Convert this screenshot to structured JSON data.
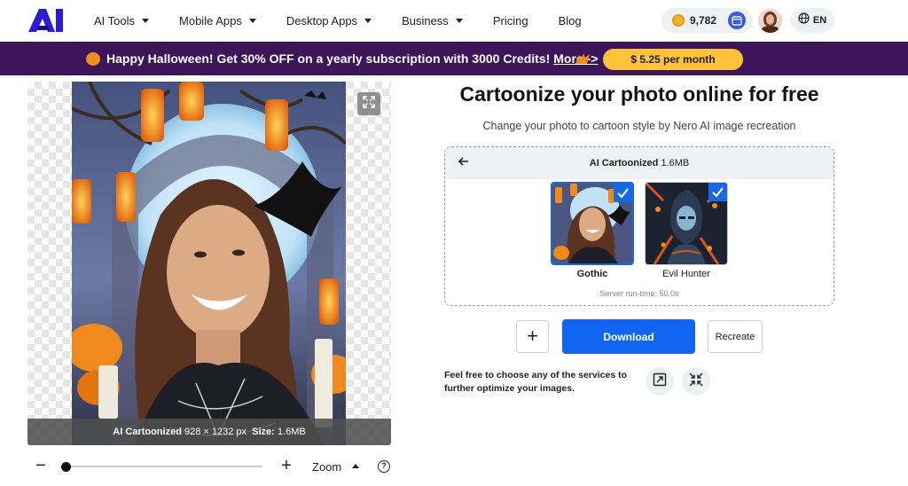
{
  "colors": {
    "brand": "#2d1cd6",
    "banner_bg": "#3d1559",
    "price_button": "#ffc23a",
    "primary": "#1265f0",
    "selected_border": "#1668e3"
  },
  "header": {
    "logo_text": "AI",
    "nav": [
      {
        "label": "AI Tools",
        "has_dropdown": true
      },
      {
        "label": "Mobile Apps",
        "has_dropdown": true
      },
      {
        "label": "Desktop Apps",
        "has_dropdown": true
      },
      {
        "label": "Business",
        "has_dropdown": true
      },
      {
        "label": "Pricing",
        "has_dropdown": false
      },
      {
        "label": "Blog",
        "has_dropdown": false
      }
    ],
    "credits": "9,782",
    "language": "EN",
    "icons": [
      "coin-icon",
      "calendar-icon",
      "user-avatar",
      "globe-icon"
    ]
  },
  "banner": {
    "text": "Happy Halloween! Get 30% OFF on a yearly subscription with 3000 Credits!",
    "link": "More ->",
    "price_button": "$ 5.25 per month"
  },
  "preview": {
    "caption_label": "AI Cartoonized",
    "caption_dims": "928 × 1232 px",
    "caption_size_label": "Size:",
    "caption_size": "1.6MB"
  },
  "zoom": {
    "minus": "−",
    "plus": "+",
    "label": "Zoom",
    "level": 0.0,
    "help": "?"
  },
  "main": {
    "title": "Cartoonize your photo online for free",
    "subtitle": "Change your photo to cartoon style by Nero AI image recreation",
    "result": {
      "title": "AI Cartoonized",
      "size": "1.6MB",
      "styles": [
        {
          "label": "Gothic",
          "selected": true
        },
        {
          "label": "Evil Hunter",
          "selected": true
        }
      ],
      "runtime": "Server run-time: 50.0s"
    },
    "add_label": "+",
    "download_label": "Download",
    "recreate_label": "Recreate",
    "services_text": "Feel free to choose any of the services to further optimize your images."
  }
}
